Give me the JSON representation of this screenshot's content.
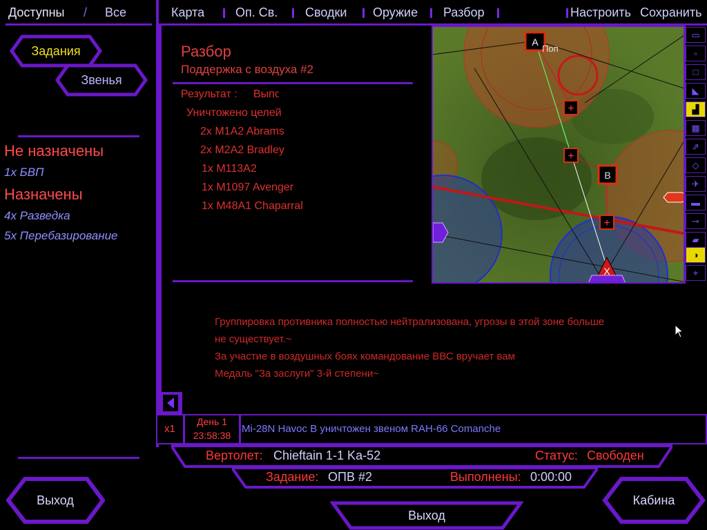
{
  "top_left": {
    "available": "Доступны",
    "slash": "/",
    "all": "Все"
  },
  "nav": {
    "map": "Карта",
    "ops": "Оп. Св.",
    "reports": "Сводки",
    "weapons": "Оружие",
    "debrief": "Разбор",
    "settings": "Настроить",
    "save": "Сохранить"
  },
  "left_tabs": {
    "tasks": "Задания",
    "flights": "Звенья"
  },
  "unassigned": {
    "heading": "Не назначены",
    "items": [
      "1x БВП"
    ]
  },
  "assigned": {
    "heading": "Назначены",
    "items": [
      "4x Разведка",
      "5x Перебазирование"
    ]
  },
  "debrief": {
    "title": "Разбор",
    "subtitle": "Поддержка с воздуха #2",
    "result_label": "Результат :",
    "result_value": "Выпо",
    "destroyed_heading": "Уничтожено целей",
    "targets": [
      "2x M1A2 Abrams",
      "2x M2A2 Bradley",
      "1x M113A2",
      "1x M1097 Avenger",
      "1x M48A1 Chaparral"
    ],
    "messages": [
      "Группировка противника полностью нейтрализована, угрозы в этой зоне больше",
      "не существует.~",
      "За участие в воздушных боях командование ВВС вручает вам",
      "Медаль \"За заслуги\" 3-й степени~"
    ]
  },
  "map": {
    "waypoint_a": "A",
    "waypoint_b": "B",
    "waypoint_x": "X",
    "label_top": "Поп",
    "icons": [
      "map-view-icon",
      "zoom-in-icon",
      "zoom-out-icon",
      "flight-path-icon",
      "terrain-icon",
      "grid-icon",
      "sam-icon",
      "radar-icon",
      "aircraft-icon",
      "armor-icon",
      "helicopter-icon",
      "vehicle-icon",
      "building-icon",
      "target-icon",
      "center-icon"
    ]
  },
  "log": {
    "speed": "x1",
    "day": "День 1",
    "time": "23:58:38",
    "message": "Mi-28N Havoc B уничтожен звеном RAH-66 Comanche"
  },
  "status": {
    "heli_label": "Вертолет:",
    "heli_value": "Chieftain 1-1 Ka-52",
    "status_label": "Статус:",
    "status_value": "Свободен",
    "task_label": "Задание:",
    "task_value": "ОПВ #2",
    "done_label": "Выполнены:",
    "done_value": "0:00:00"
  },
  "buttons": {
    "exit_left": "Выход",
    "exit_center": "Выход",
    "cockpit": "Кабина"
  },
  "colors": {
    "purple": "#6a18c8",
    "red_text": "#e03030",
    "map_green": "#4a6a22"
  }
}
